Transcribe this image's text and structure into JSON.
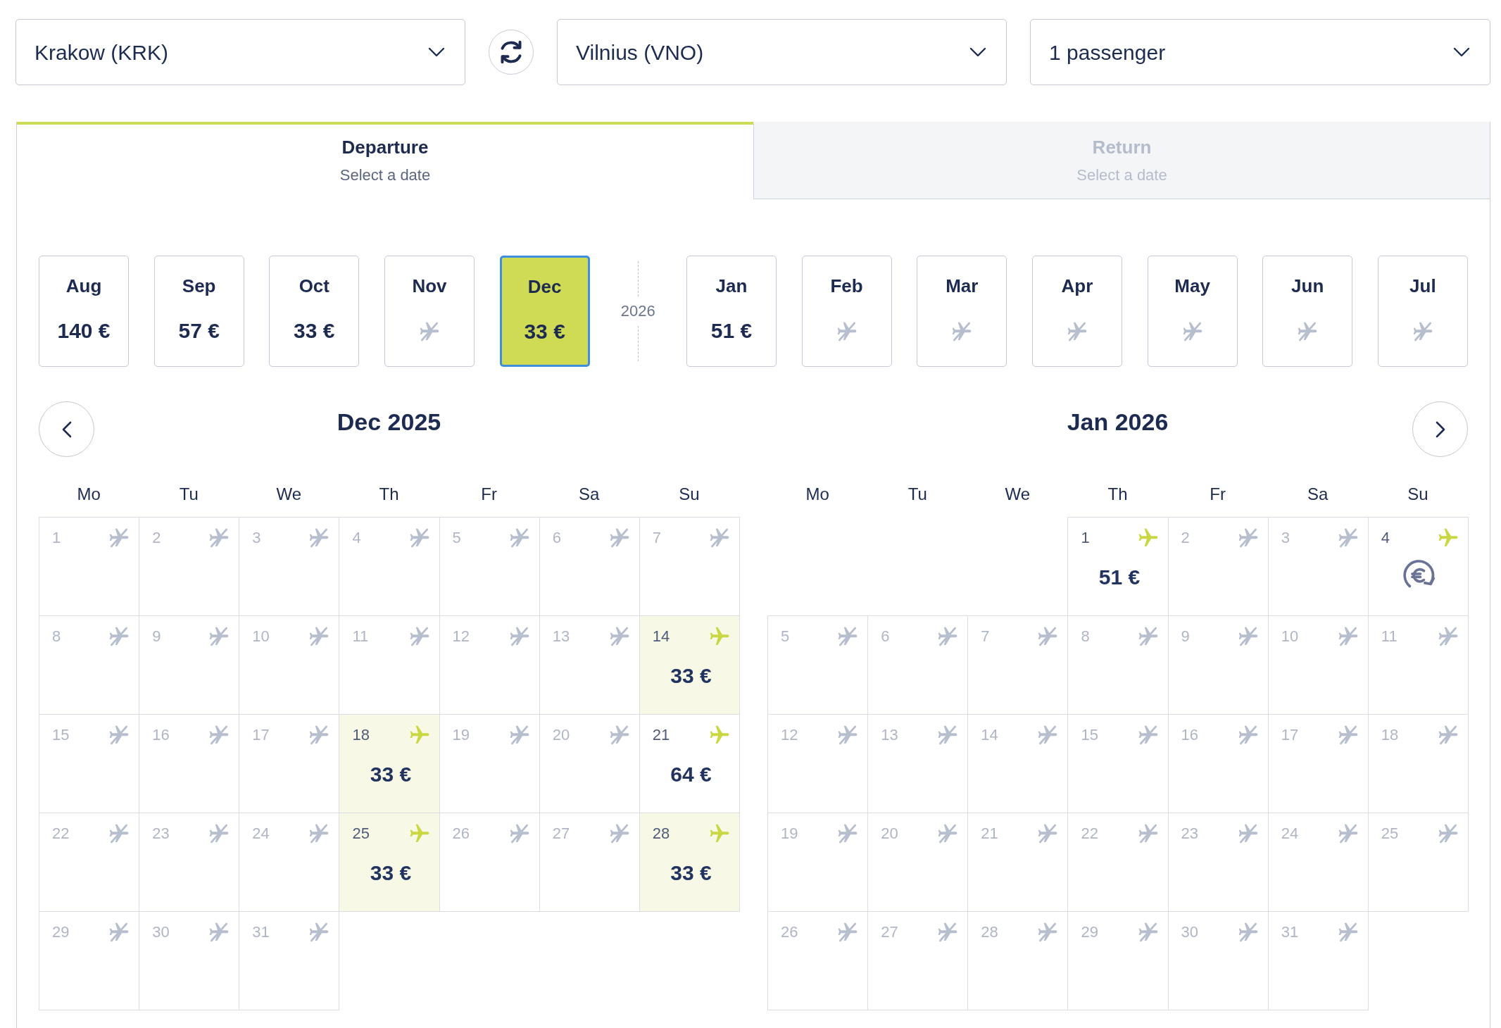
{
  "from": {
    "value": "Krakow (KRK)"
  },
  "to": {
    "value": "Vilnius (VNO)"
  },
  "passengers": {
    "value": "1 passenger"
  },
  "tabs": [
    {
      "title": "Departure",
      "subtitle": "Select a date",
      "selected": true
    },
    {
      "title": "Return",
      "subtitle": "Select a date",
      "selected": false
    }
  ],
  "month_strip": [
    {
      "kind": "fare",
      "month": "Aug",
      "price": "140 €",
      "selected": false
    },
    {
      "kind": "fare",
      "month": "Sep",
      "price": "57 €",
      "selected": false
    },
    {
      "kind": "fare",
      "month": "Oct",
      "price": "33 €",
      "selected": false
    },
    {
      "kind": "no-flight",
      "month": "Nov",
      "selected": false
    },
    {
      "kind": "fare",
      "month": "Dec",
      "price": "33 €",
      "selected": true
    },
    {
      "kind": "year",
      "label": "2026"
    },
    {
      "kind": "fare",
      "month": "Jan",
      "price": "51 €",
      "selected": false
    },
    {
      "kind": "no-flight",
      "month": "Feb",
      "selected": false
    },
    {
      "kind": "no-flight",
      "month": "Mar",
      "selected": false
    },
    {
      "kind": "no-flight",
      "month": "Apr",
      "selected": false
    },
    {
      "kind": "no-flight",
      "month": "May",
      "selected": false
    },
    {
      "kind": "no-flight",
      "month": "Jun",
      "selected": false
    },
    {
      "kind": "no-flight",
      "month": "Jul",
      "selected": false
    }
  ],
  "calendars": [
    {
      "title": "Dec 2025",
      "weekdays": [
        "Mo",
        "Tu",
        "We",
        "Th",
        "Fr",
        "Sa",
        "Su"
      ],
      "weeks": [
        [
          {
            "day": "1",
            "kind": "no-flight",
            "highlighted": false
          },
          {
            "day": "2",
            "kind": "no-flight",
            "highlighted": false
          },
          {
            "day": "3",
            "kind": "no-flight",
            "highlighted": false
          },
          {
            "day": "4",
            "kind": "no-flight",
            "highlighted": false
          },
          {
            "day": "5",
            "kind": "no-flight",
            "highlighted": false
          },
          {
            "day": "6",
            "kind": "no-flight",
            "highlighted": false
          },
          {
            "day": "7",
            "kind": "no-flight",
            "highlighted": false
          }
        ],
        [
          {
            "day": "8",
            "kind": "no-flight",
            "highlighted": false
          },
          {
            "day": "9",
            "kind": "no-flight",
            "highlighted": false
          },
          {
            "day": "10",
            "kind": "no-flight",
            "highlighted": false
          },
          {
            "day": "11",
            "kind": "no-flight",
            "highlighted": false
          },
          {
            "day": "12",
            "kind": "no-flight",
            "highlighted": false
          },
          {
            "day": "13",
            "kind": "no-flight",
            "highlighted": false
          },
          {
            "day": "14",
            "kind": "fare",
            "price": "33 €",
            "highlighted": true
          }
        ],
        [
          {
            "day": "15",
            "kind": "no-flight",
            "highlighted": false
          },
          {
            "day": "16",
            "kind": "no-flight",
            "highlighted": false
          },
          {
            "day": "17",
            "kind": "no-flight",
            "highlighted": false
          },
          {
            "day": "18",
            "kind": "fare",
            "price": "33 €",
            "highlighted": true
          },
          {
            "day": "19",
            "kind": "no-flight",
            "highlighted": false
          },
          {
            "day": "20",
            "kind": "no-flight",
            "highlighted": false
          },
          {
            "day": "21",
            "kind": "fare",
            "price": "64 €",
            "highlighted": false
          }
        ],
        [
          {
            "day": "22",
            "kind": "no-flight",
            "highlighted": false
          },
          {
            "day": "23",
            "kind": "no-flight",
            "highlighted": false
          },
          {
            "day": "24",
            "kind": "no-flight",
            "highlighted": false
          },
          {
            "day": "25",
            "kind": "fare",
            "price": "33 €",
            "highlighted": true
          },
          {
            "day": "26",
            "kind": "no-flight",
            "highlighted": false
          },
          {
            "day": "27",
            "kind": "no-flight",
            "highlighted": false
          },
          {
            "day": "28",
            "kind": "fare",
            "price": "33 €",
            "highlighted": true
          }
        ],
        [
          {
            "day": "29",
            "kind": "no-flight",
            "highlighted": false
          },
          {
            "day": "30",
            "kind": "no-flight",
            "highlighted": false
          },
          {
            "day": "31",
            "kind": "no-flight",
            "highlighted": false
          }
        ]
      ]
    },
    {
      "title": "Jan 2026",
      "weekdays": [
        "Mo",
        "Tu",
        "We",
        "Th",
        "Fr",
        "Sa",
        "Su"
      ],
      "weeks": [
        [
          {
            "day": "1",
            "kind": "fare",
            "price": "51 €",
            "highlighted": false
          },
          {
            "day": "2",
            "kind": "no-flight",
            "highlighted": false
          },
          {
            "day": "3",
            "kind": "no-flight",
            "highlighted": false
          },
          {
            "day": "4",
            "kind": "fare-check",
            "highlighted": false
          }
        ],
        [
          {
            "day": "5",
            "kind": "no-flight",
            "highlighted": false
          },
          {
            "day": "6",
            "kind": "no-flight",
            "highlighted": false
          },
          {
            "day": "7",
            "kind": "no-flight",
            "highlighted": false
          },
          {
            "day": "8",
            "kind": "no-flight",
            "highlighted": false
          },
          {
            "day": "9",
            "kind": "no-flight",
            "highlighted": false
          },
          {
            "day": "10",
            "kind": "no-flight",
            "highlighted": false
          },
          {
            "day": "11",
            "kind": "no-flight",
            "highlighted": false
          }
        ],
        [
          {
            "day": "12",
            "kind": "no-flight",
            "highlighted": false
          },
          {
            "day": "13",
            "kind": "no-flight",
            "highlighted": false
          },
          {
            "day": "14",
            "kind": "no-flight",
            "highlighted": false
          },
          {
            "day": "15",
            "kind": "no-flight",
            "highlighted": false
          },
          {
            "day": "16",
            "kind": "no-flight",
            "highlighted": false
          },
          {
            "day": "17",
            "kind": "no-flight",
            "highlighted": false
          },
          {
            "day": "18",
            "kind": "no-flight",
            "highlighted": false
          }
        ],
        [
          {
            "day": "19",
            "kind": "no-flight",
            "highlighted": false
          },
          {
            "day": "20",
            "kind": "no-flight",
            "highlighted": false
          },
          {
            "day": "21",
            "kind": "no-flight",
            "highlighted": false
          },
          {
            "day": "22",
            "kind": "no-flight",
            "highlighted": false
          },
          {
            "day": "23",
            "kind": "no-flight",
            "highlighted": false
          },
          {
            "day": "24",
            "kind": "no-flight",
            "highlighted": false
          },
          {
            "day": "25",
            "kind": "no-flight",
            "highlighted": false
          }
        ],
        [
          {
            "day": "26",
            "kind": "no-flight",
            "highlighted": false
          },
          {
            "day": "27",
            "kind": "no-flight",
            "highlighted": false
          },
          {
            "day": "28",
            "kind": "no-flight",
            "highlighted": false
          },
          {
            "day": "29",
            "kind": "no-flight",
            "highlighted": false
          },
          {
            "day": "30",
            "kind": "no-flight",
            "highlighted": false
          },
          {
            "day": "31",
            "kind": "no-flight",
            "highlighted": false
          }
        ]
      ]
    }
  ]
}
